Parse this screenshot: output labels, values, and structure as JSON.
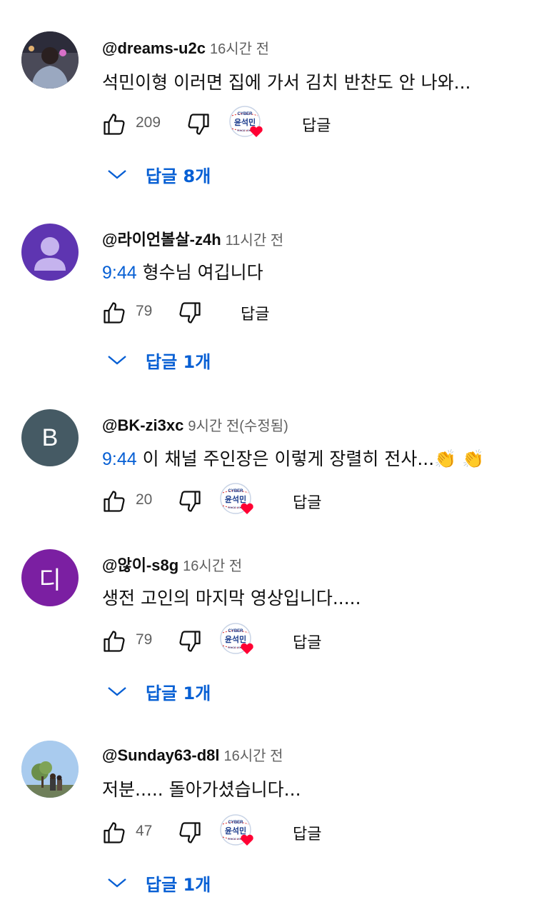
{
  "colors": {
    "link": "#065fd4",
    "meta": "#606060",
    "text": "#0f0f0f"
  },
  "comments": [
    {
      "author": "@dreams-u2c",
      "time": "16시간 전",
      "timestamp_link": "",
      "text": "석민이형 이러면 집에 가서 김치 반찬도 안 나와...",
      "emoji": "",
      "likes": "209",
      "reply_label": "답글",
      "replies_label": "답글 8개",
      "avatar": {
        "type": "photo",
        "icon": "person-photo-avatar"
      },
      "creator_heart": true
    },
    {
      "author": "@라이언볼살-z4h",
      "time": "11시간 전",
      "timestamp_link": "9:44",
      "text": " 형수님 여깁니다",
      "emoji": "",
      "likes": "79",
      "reply_label": "답글",
      "replies_label": "답글 1개",
      "avatar": {
        "type": "default",
        "color": "#5e35b1",
        "icon": "default-person-avatar"
      },
      "creator_heart": false
    },
    {
      "author": "@BK-zi3xc",
      "time": "9시간 전(수정됨)",
      "timestamp_link": "9:44",
      "text": " 이 채널 주인장은 이렇게 장렬히 전사...",
      "emoji": "👏 👏",
      "likes": "20",
      "reply_label": "답글",
      "replies_label": "",
      "avatar": {
        "type": "letter",
        "letter": "B",
        "color": "#455a64"
      },
      "creator_heart": true
    },
    {
      "author": "@않이-s8g",
      "time": "16시간 전",
      "timestamp_link": "",
      "text": "생전 고인의 마지막 영상입니다.....",
      "emoji": "",
      "likes": "79",
      "reply_label": "답글",
      "replies_label": "답글 1개",
      "avatar": {
        "type": "letter",
        "letter": "디",
        "color": "#7b1fa2"
      },
      "creator_heart": true
    },
    {
      "author": "@Sunday63-d8l",
      "time": "16시간 전",
      "timestamp_link": "",
      "text": "저분..... 돌아가셨습니다...",
      "emoji": "",
      "likes": "47",
      "reply_label": "답글",
      "replies_label": "답글 1개",
      "avatar": {
        "type": "photo",
        "icon": "outdoor-photo-avatar"
      },
      "creator_heart": true
    }
  ],
  "badge": {
    "top_text": "CYBER",
    "main_text": "윤석민",
    "bottom_text": "SINCE 2005"
  }
}
